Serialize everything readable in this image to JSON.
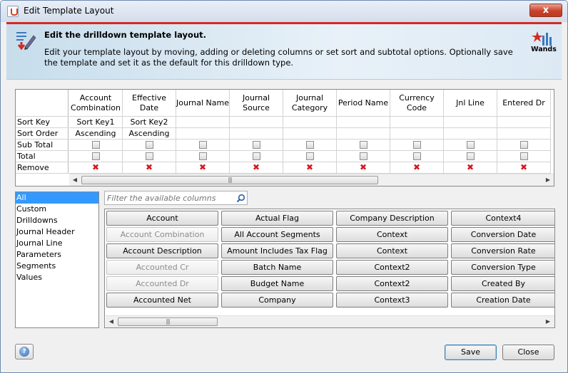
{
  "window": {
    "title": "Edit Template Layout",
    "close_glyph": "x"
  },
  "banner": {
    "title": "Edit the drilldown template layout.",
    "text": "Edit your template layout by moving, adding or deleting columns or set sort and subtotal options. Optionally save the template and set it as the default for this drilldown type.",
    "logo_label": "Wands"
  },
  "layout_table": {
    "row_labels": [
      "Sort Key",
      "Sort Order",
      "Sub Total",
      "Total",
      "Remove"
    ],
    "columns": [
      {
        "header": "Account Combination",
        "sort_key": "Sort Key1",
        "sort_order": "Ascending"
      },
      {
        "header": "Effective Date",
        "sort_key": "Sort Key2",
        "sort_order": "Ascending"
      },
      {
        "header": "Journal Name",
        "sort_key": "",
        "sort_order": ""
      },
      {
        "header": "Journal Source",
        "sort_key": "",
        "sort_order": ""
      },
      {
        "header": "Journal Category",
        "sort_key": "",
        "sort_order": ""
      },
      {
        "header": "Period Name",
        "sort_key": "",
        "sort_order": ""
      },
      {
        "header": "Currency Code",
        "sort_key": "",
        "sort_order": ""
      },
      {
        "header": "Jnl Line",
        "sort_key": "",
        "sort_order": ""
      },
      {
        "header": "Entered Dr",
        "sort_key": "",
        "sort_order": ""
      }
    ],
    "remove_glyph": "✖",
    "scroll_grip": "|||"
  },
  "categories": {
    "items": [
      "All",
      "Custom",
      "Drilldowns",
      "Journal Header",
      "Journal Line",
      "Parameters",
      "Segments",
      "Values"
    ],
    "selected": "All"
  },
  "search": {
    "placeholder": "Filter the available columns",
    "value": ""
  },
  "available_columns": [
    [
      {
        "label": "Account",
        "enabled": true
      },
      {
        "label": "Actual Flag",
        "enabled": true
      },
      {
        "label": "Company Description",
        "enabled": true
      },
      {
        "label": "Context4",
        "enabled": true
      }
    ],
    [
      {
        "label": "Account Combination",
        "enabled": false
      },
      {
        "label": "All Account Segments",
        "enabled": true
      },
      {
        "label": "Context",
        "enabled": true
      },
      {
        "label": "Conversion Date",
        "enabled": true
      }
    ],
    [
      {
        "label": "Account Description",
        "enabled": true
      },
      {
        "label": "Amount Includes Tax Flag",
        "enabled": true
      },
      {
        "label": "Context",
        "enabled": true
      },
      {
        "label": "Conversion Rate",
        "enabled": true
      }
    ],
    [
      {
        "label": "Accounted Cr",
        "enabled": false
      },
      {
        "label": "Batch Name",
        "enabled": true
      },
      {
        "label": "Context2",
        "enabled": true
      },
      {
        "label": "Conversion Type",
        "enabled": true
      }
    ],
    [
      {
        "label": "Accounted Dr",
        "enabled": false
      },
      {
        "label": "Budget Name",
        "enabled": true
      },
      {
        "label": "Context2",
        "enabled": true
      },
      {
        "label": "Created By",
        "enabled": true
      }
    ],
    [
      {
        "label": "Accounted Net",
        "enabled": true
      },
      {
        "label": "Company",
        "enabled": true
      },
      {
        "label": "Context3",
        "enabled": true
      },
      {
        "label": "Creation Date",
        "enabled": true
      }
    ]
  ],
  "buttons": {
    "help": "?",
    "save": "Save",
    "close": "Close"
  },
  "colors": {
    "accent_red": "#d42a22",
    "selection": "#3399ff",
    "remove_x": "#d6181e"
  }
}
